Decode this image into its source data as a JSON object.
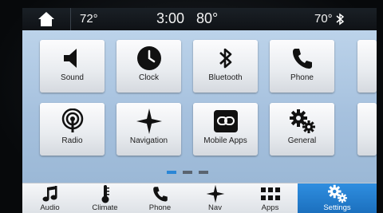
{
  "status": {
    "left_temp": "72°",
    "time": "3:00",
    "outside_temp": "80°",
    "right_temp": "70°"
  },
  "tiles": [
    {
      "label": "Sound",
      "icon": "speaker-icon"
    },
    {
      "label": "Clock",
      "icon": "clock-icon"
    },
    {
      "label": "Bluetooth",
      "icon": "bluetooth-icon"
    },
    {
      "label": "Phone",
      "icon": "phone-icon"
    },
    {
      "label": "Radio",
      "icon": "radio-icon"
    },
    {
      "label": "Navigation",
      "icon": "compass-star-icon"
    },
    {
      "label": "Mobile Apps",
      "icon": "link-icon"
    },
    {
      "label": "General",
      "icon": "gears-icon"
    }
  ],
  "page_indicator": {
    "pages": 3,
    "current": 1
  },
  "bottom_bar": [
    {
      "label": "Audio",
      "icon": "music-note-icon"
    },
    {
      "label": "Climate",
      "icon": "thermometer-icon"
    },
    {
      "label": "Phone",
      "icon": "phone-icon"
    },
    {
      "label": "Nav",
      "icon": "compass-star-icon"
    },
    {
      "label": "Apps",
      "icon": "apps-grid-icon"
    },
    {
      "label": "Settings",
      "icon": "gears-icon",
      "selected": true
    }
  ],
  "colors": {
    "accent": "#1b6fbd",
    "content_bg": "#a6c1de",
    "status_bg": "#0f1216"
  }
}
